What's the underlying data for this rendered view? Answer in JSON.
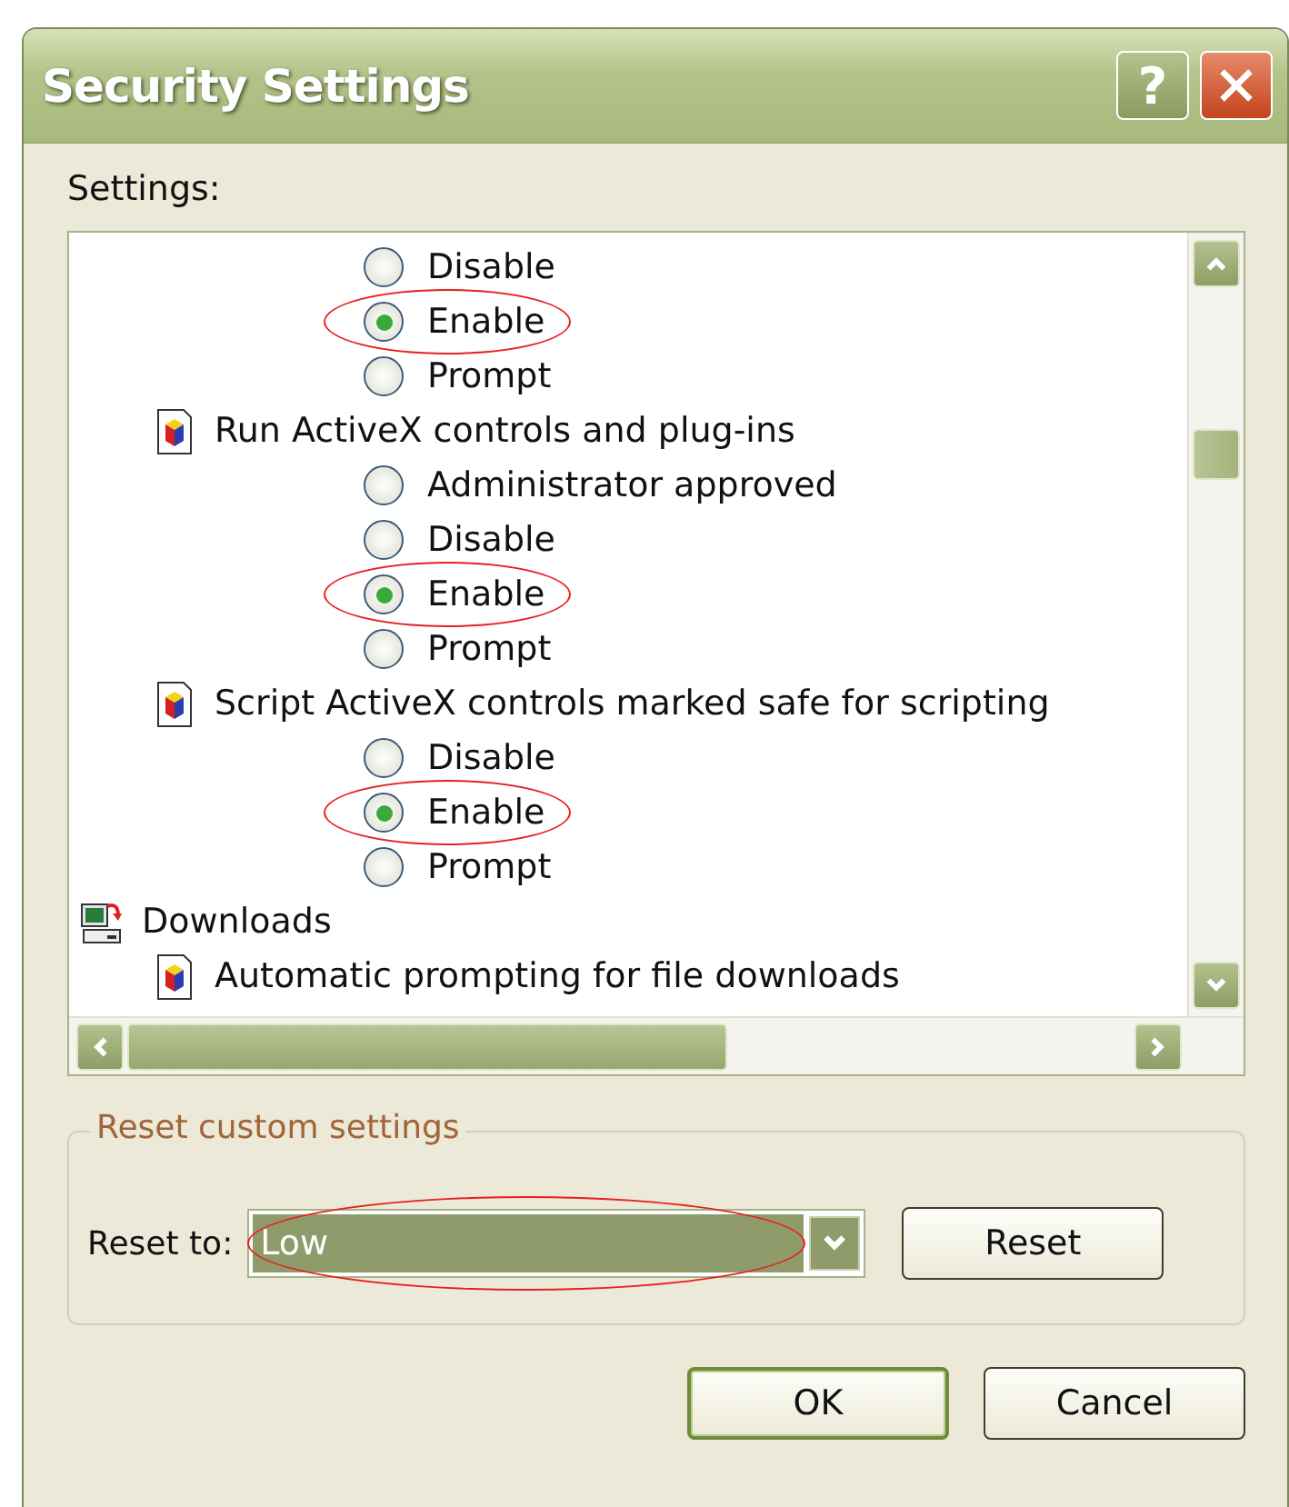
{
  "window": {
    "title": "Security Settings",
    "help_button": "?"
  },
  "settings_label": "Settings:",
  "tree": [
    {
      "kind": "category",
      "children": [
        {
          "kind": "setting",
          "children": [
            {
              "kind": "option",
              "label": "Disable",
              "selected": false,
              "circled": false
            },
            {
              "kind": "option",
              "label": "Enable",
              "selected": true,
              "circled": true
            },
            {
              "kind": "option",
              "label": "Prompt",
              "selected": false,
              "circled": false
            }
          ]
        },
        {
          "kind": "setting",
          "label": "Run ActiveX controls and plug-ins",
          "children": [
            {
              "kind": "option",
              "label": "Administrator approved",
              "selected": false,
              "circled": false
            },
            {
              "kind": "option",
              "label": "Disable",
              "selected": false,
              "circled": false
            },
            {
              "kind": "option",
              "label": "Enable",
              "selected": true,
              "circled": true
            },
            {
              "kind": "option",
              "label": "Prompt",
              "selected": false,
              "circled": false
            }
          ]
        },
        {
          "kind": "setting",
          "label": "Script ActiveX controls marked safe for scripting",
          "children": [
            {
              "kind": "option",
              "label": "Disable",
              "selected": false,
              "circled": false
            },
            {
              "kind": "option",
              "label": "Enable",
              "selected": true,
              "circled": true
            },
            {
              "kind": "option",
              "label": "Prompt",
              "selected": false,
              "circled": false
            }
          ]
        }
      ]
    },
    {
      "kind": "category",
      "label": "Downloads",
      "children": [
        {
          "kind": "setting",
          "label": "Automatic prompting for file downloads"
        }
      ]
    }
  ],
  "reset_group": {
    "legend": "Reset custom settings",
    "label": "Reset to:",
    "value": "Low",
    "circled": true,
    "button": "Reset"
  },
  "buttons": [
    {
      "label": "OK",
      "default": true
    },
    {
      "label": "Cancel",
      "default": false
    }
  ]
}
